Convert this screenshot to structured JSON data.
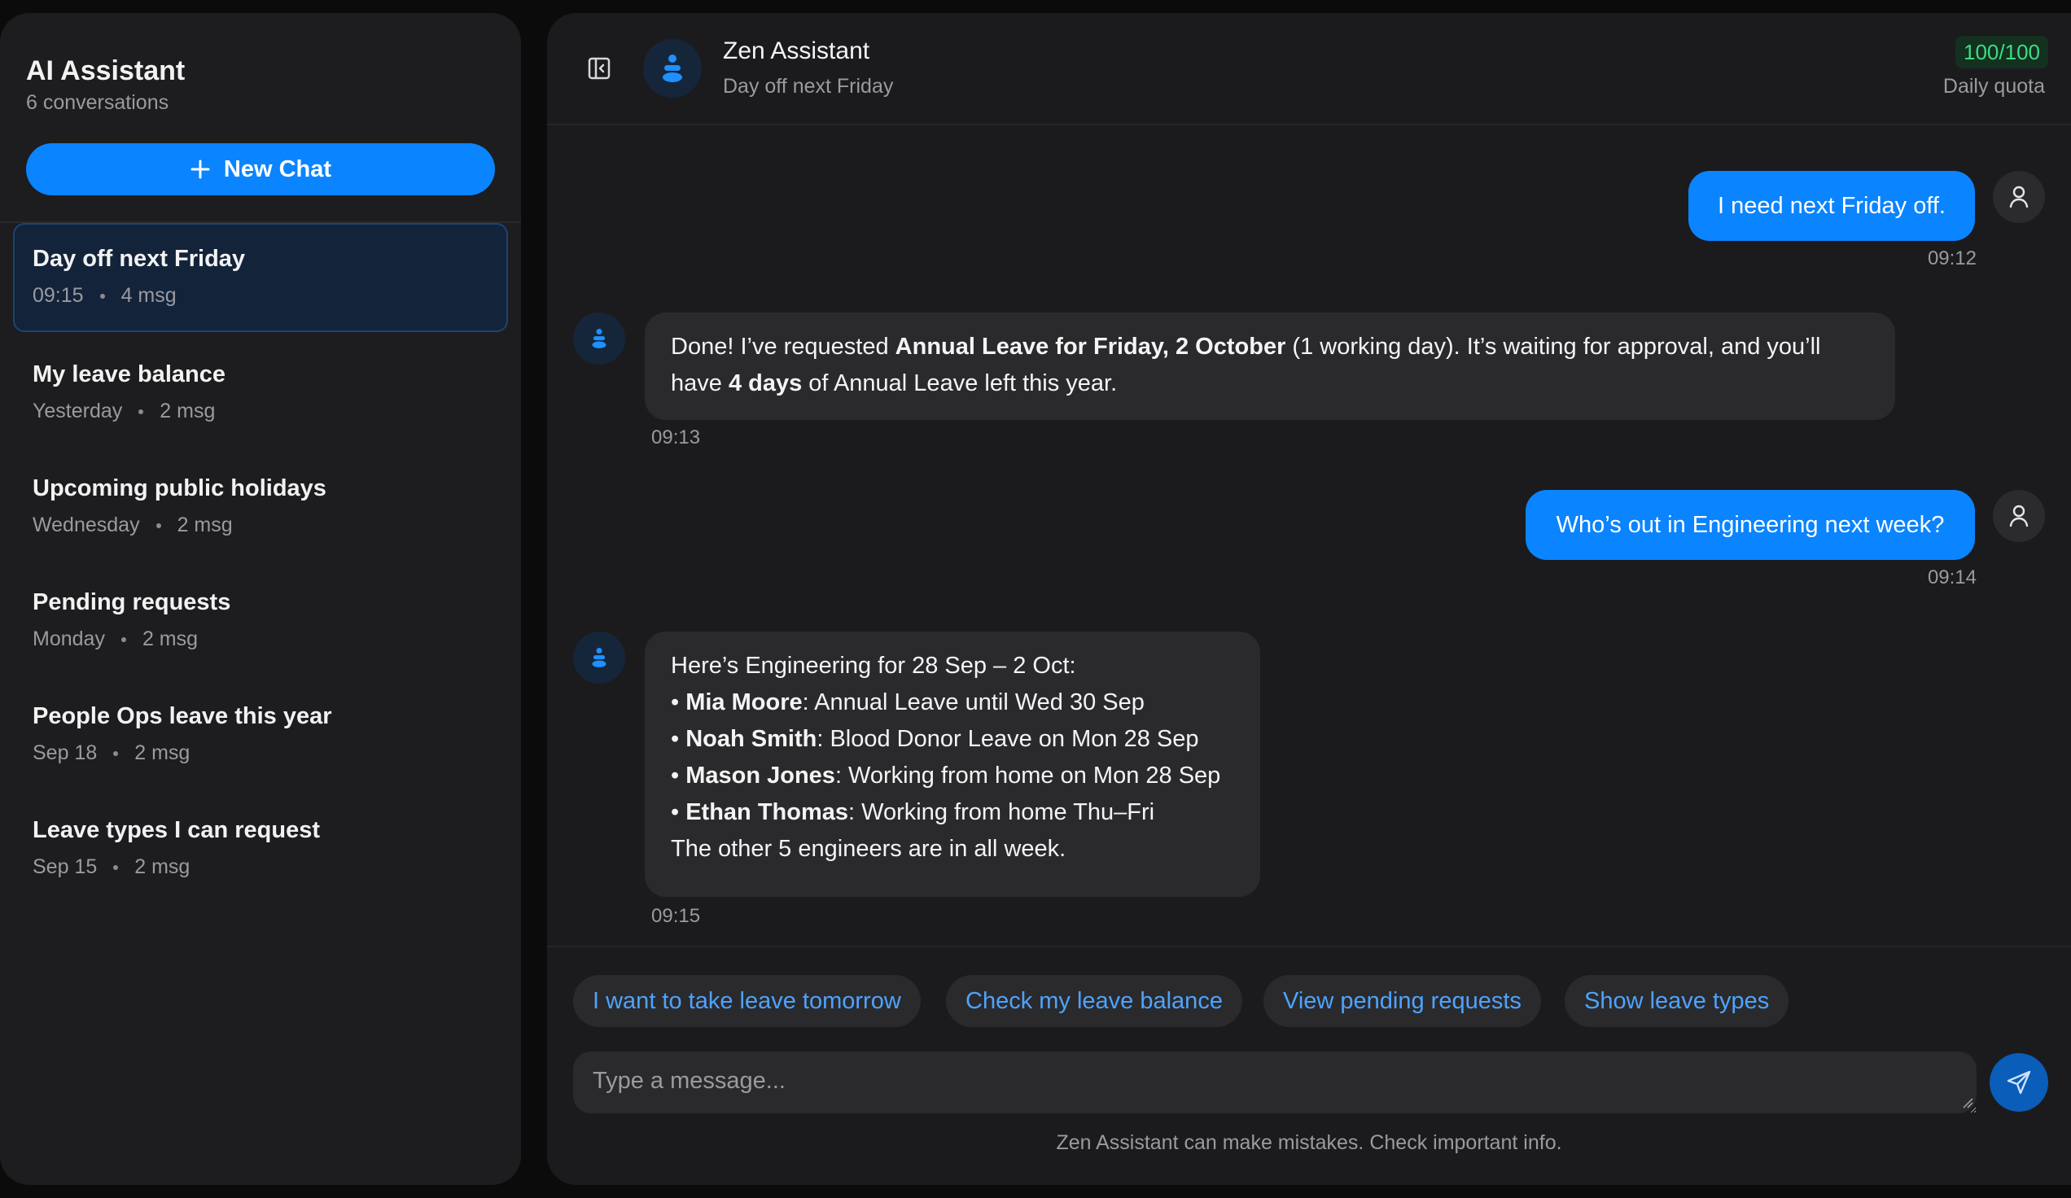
{
  "sidebar": {
    "title": "AI Assistant",
    "count": "6 conversations",
    "new_chat_label": "New Chat",
    "conversations": [
      {
        "title": "Day off next Friday",
        "time": "09:15",
        "msgs": "4 msg"
      },
      {
        "title": "My leave balance",
        "time": "Yesterday",
        "msgs": "2 msg"
      },
      {
        "title": "Upcoming public holidays",
        "time": "Wednesday",
        "msgs": "2 msg"
      },
      {
        "title": "Pending requests",
        "time": "Monday",
        "msgs": "2 msg"
      },
      {
        "title": "People Ops leave this year",
        "time": "Sep 18",
        "msgs": "2 msg"
      },
      {
        "title": "Leave types I can request",
        "time": "Sep 15",
        "msgs": "2 msg"
      }
    ]
  },
  "header": {
    "assistant_name": "Zen Assistant",
    "conversation_title": "Day off next Friday",
    "quota": "100/100",
    "quota_label": "Daily quota"
  },
  "messages": [
    {
      "role": "user",
      "text": "I need next Friday off.",
      "time": "09:12"
    },
    {
      "role": "assistant",
      "time": "09:13",
      "parts": [
        "Done! I’ve requested ",
        "Annual Leave for Friday, 2 October",
        " (1 working day). It’s waiting for approval, and you’ll",
        "have ",
        "4 days",
        " of Annual Leave left this year."
      ]
    },
    {
      "role": "user",
      "text": "Who’s out in Engineering next week?",
      "time": "09:14"
    },
    {
      "role": "assistant",
      "time": "09:15",
      "intro": "Here’s Engineering for 28 Sep – 2 Oct:",
      "bullets": [
        {
          "bullet": "•",
          "name": "Mia Moore",
          "detail": ": Annual Leave until Wed 30 Sep"
        },
        {
          "bullet": "•",
          "name": "Noah Smith",
          "detail": ": Blood Donor Leave on Mon 28 Sep"
        },
        {
          "bullet": "•",
          "name": "Mason Jones",
          "detail": ": Working from home on Mon 28 Sep"
        },
        {
          "bullet": "•",
          "name": "Ethan Thomas",
          "detail": ": Working from home Thu–Fri"
        }
      ],
      "outro": "The other 5 engineers are in all week."
    }
  ],
  "suggestions": [
    "I want to take leave tomorrow",
    "Check my leave balance",
    "View pending requests",
    "Show leave types"
  ],
  "composer": {
    "placeholder": "Type a message...",
    "disclaimer": "Zen Assistant can make mistakes. Check important info."
  },
  "colors": {
    "accent": "#0a84ff",
    "quota_green": "#3ddc84",
    "suggestion_text": "#4ea3ff"
  },
  "icons": [
    "plus-icon",
    "panel-toggle-icon",
    "bot-icon",
    "user-icon",
    "send-icon"
  ]
}
